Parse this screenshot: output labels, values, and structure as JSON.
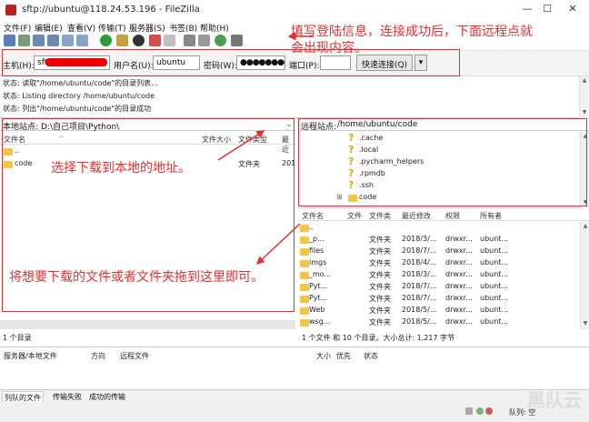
{
  "window": {
    "title": "sftp://ubuntu@118.24.53.196 - FileZilla",
    "controls": [
      "—",
      "☐",
      "✕"
    ]
  },
  "menu": [
    "文件(F)",
    "编辑(E)",
    "查看(V)",
    "传输(T)",
    "服务器(S)",
    "书签(B)",
    "帮助(H)"
  ],
  "quickconnect": {
    "host_label": "主机(H):",
    "host_value": "sftp://",
    "user_label": "用户名(U):",
    "user_value": "ubuntu",
    "pass_label": "密码(W):",
    "pass_value": "●●●●●●●●",
    "port_label": "端口(P):",
    "port_value": "",
    "connect_label": "快速连接(Q)",
    "dropdown_label": "▾"
  },
  "log": [
    "状态:  读取\"/home/ubuntu/code\"的目录列表...",
    "状态:  Listing directory /home/ubuntu/code",
    "状态:  列出\"/home/ubuntu/code\"的目录成功"
  ],
  "local": {
    "site_label": "本地站点:",
    "site_path": "D:\\自己项目\\Python\\",
    "columns": [
      "文件名",
      "文件大小",
      "文件类型",
      "最近"
    ],
    "rows": [
      {
        "name": "..",
        "type": "",
        "mod": ""
      },
      {
        "name": "code",
        "type": "文件夹",
        "mod": "201"
      }
    ],
    "status": "1 个目录"
  },
  "remote": {
    "site_label": "远程站点:",
    "site_path": "/home/ubuntu/code",
    "tree": [
      ".cache",
      ".local",
      ".pycharm_helpers",
      ".rpmdb",
      ".ssh",
      "code"
    ],
    "tree_expander": "⊞",
    "columns": [
      "文件名",
      "文件",
      "文件类",
      "最近修改",
      "权限",
      "所有者"
    ],
    "rows": [
      {
        "name": "..",
        "type": "",
        "mod": "",
        "perm": "",
        "owner": ""
      },
      {
        "name": "_p...",
        "type": "文件夹",
        "mod": "2018/3/...",
        "perm": "drwxr...",
        "owner": "ubunt..."
      },
      {
        "name": "files",
        "type": "文件夹",
        "mod": "2018/7/...",
        "perm": "drwxr...",
        "owner": "ubunt..."
      },
      {
        "name": "imgs",
        "type": "文件夹",
        "mod": "2018/4/...",
        "perm": "drwxr...",
        "owner": "ubunt..."
      },
      {
        "name": "_mo...",
        "type": "文件夹",
        "mod": "2018/3/...",
        "perm": "drwxr...",
        "owner": "ubunt..."
      },
      {
        "name": "Pyt...",
        "type": "文件夹",
        "mod": "2018/7/...",
        "perm": "drwxr...",
        "owner": "ubunt..."
      },
      {
        "name": "Pyt...",
        "type": "文件夹",
        "mod": "2018/7/...",
        "perm": "drwxr...",
        "owner": "ubunt..."
      },
      {
        "name": "Web",
        "type": "文件夹",
        "mod": "2018/5/...",
        "perm": "drwxr...",
        "owner": "ubunt..."
      },
      {
        "name": "wsg...",
        "type": "文件夹",
        "mod": "2018/5/...",
        "perm": "drwxr...",
        "owner": "ubunt..."
      }
    ],
    "status": "1 个文件 和 10 个目录。大小总计: 1,217 字节"
  },
  "queue_columns": [
    "服务器/本地文件",
    "方向",
    "远程文件",
    "大小",
    "优先",
    "状态"
  ],
  "queue_tabs": [
    "列队的文件",
    "传输失败",
    "成功的传输"
  ],
  "bottom": {
    "queue_status": "队列: 空",
    "watermark": "黑队云"
  },
  "annotations": {
    "login": "填写登陆信息，连接成功后，下面远程点就",
    "login2": "会出现内容。",
    "local": "选择下载到本地的地址。",
    "drag": "将想要下载的文件或者文件夹拖到这里即可。"
  },
  "colors": {
    "annotation": "#e53030",
    "folder": "#f3c648",
    "unknown": "#e0a800"
  }
}
